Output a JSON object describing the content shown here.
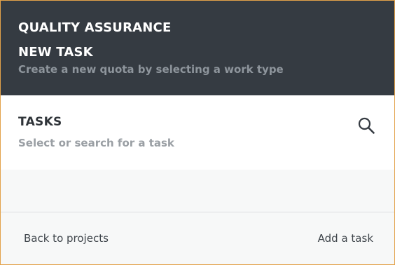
{
  "header": {
    "app_title": "QUALITY ASSURANCE",
    "task_title": "NEW TASK",
    "subtitle": "Create a new quota by selecting a work type"
  },
  "tasks": {
    "title": "TASKS",
    "subtitle": "Select or search for a task",
    "search_icon": "search-icon"
  },
  "footer": {
    "back_label": "Back to projects",
    "add_label": "Add a task"
  },
  "colors": {
    "header_bg": "#353b42",
    "frame_border": "#e3a24a",
    "muted_text": "#9a9fa4"
  }
}
